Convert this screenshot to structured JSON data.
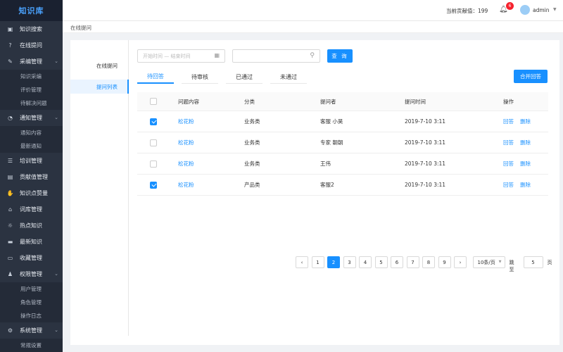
{
  "app": {
    "logo": "知识库"
  },
  "sidebar": {
    "items": [
      {
        "label": "知识搜索",
        "icon": "book-icon",
        "glyph": "▣"
      },
      {
        "label": "在线提问",
        "icon": "question-icon",
        "glyph": "?"
      },
      {
        "label": "采编管理",
        "icon": "edit-icon",
        "glyph": "✎",
        "expandable": true,
        "children": [
          "知识采编",
          "评价管理",
          "待解决问题"
        ]
      },
      {
        "label": "通知管理",
        "icon": "bell-icon",
        "glyph": "◔",
        "expandable": true,
        "children": [
          "通知内容",
          "最新通知"
        ]
      },
      {
        "label": "培训管理",
        "icon": "training-icon",
        "glyph": "☰"
      },
      {
        "label": "贡献值管理",
        "icon": "chart-icon",
        "glyph": "▤"
      },
      {
        "label": "知识点赞量",
        "icon": "thumb-up-icon",
        "glyph": "✋"
      },
      {
        "label": "词库管理",
        "icon": "dictionary-icon",
        "glyph": "⌂"
      },
      {
        "label": "热点知识",
        "icon": "hot-icon",
        "glyph": "☼"
      },
      {
        "label": "最新知识",
        "icon": "new-icon",
        "glyph": "▬"
      },
      {
        "label": "收藏管理",
        "icon": "bookmark-icon",
        "glyph": "▭"
      },
      {
        "label": "权限管理",
        "icon": "permission-icon",
        "glyph": "♟",
        "expandable": true,
        "children": [
          "用户管理",
          "角色管理",
          "操作日志"
        ]
      },
      {
        "label": "系统管理",
        "icon": "settings-icon",
        "glyph": "⚙",
        "expandable": true,
        "children": [
          "常规设置"
        ]
      }
    ]
  },
  "header": {
    "contribution": "当前贡献值：199",
    "notification_count": "6",
    "username": "admin"
  },
  "breadcrumb": "在线提问",
  "subnav": [
    "在线提问",
    "提问列表"
  ],
  "filters": {
    "date_placeholder": "开始时间 — 结束时间",
    "search_placeholder": "",
    "query_label": "查 询"
  },
  "tabs": [
    "待回答",
    "待审核",
    "已通过",
    "未通过"
  ],
  "merge_label": "合并回答",
  "table": {
    "headers": [
      "问题内容",
      "分类",
      "提问者",
      "提问时间",
      "操作"
    ],
    "rows": [
      {
        "checked": true,
        "question": "松花粉",
        "category": "业务类",
        "asker": "客服 小昊",
        "time": "2019-7-10 3:11"
      },
      {
        "checked": false,
        "question": "松花粉",
        "category": "业务类",
        "asker": "专家 朝朝",
        "time": "2019-7-10 3:11"
      },
      {
        "checked": false,
        "question": "松花粉",
        "category": "业务类",
        "asker": "王伟",
        "time": "2019-7-10 3:11"
      },
      {
        "checked": true,
        "question": "松花粉",
        "category": "产品类",
        "asker": "客服2",
        "time": "2019-7-10 3:11"
      }
    ],
    "ops": {
      "answer": "回答",
      "delete": "删除"
    }
  },
  "pagination": {
    "prev": "‹",
    "pages": [
      "1",
      "2",
      "3",
      "4",
      "5",
      "6",
      "7",
      "8",
      "9"
    ],
    "current": "2",
    "next": "›",
    "page_size": "10条/页",
    "jump_label": "跳至",
    "jump_value": "5",
    "page_unit": "页"
  },
  "colors": {
    "primary": "#1890ff",
    "sidebar": "#2b3341",
    "danger": "#f5222d"
  }
}
